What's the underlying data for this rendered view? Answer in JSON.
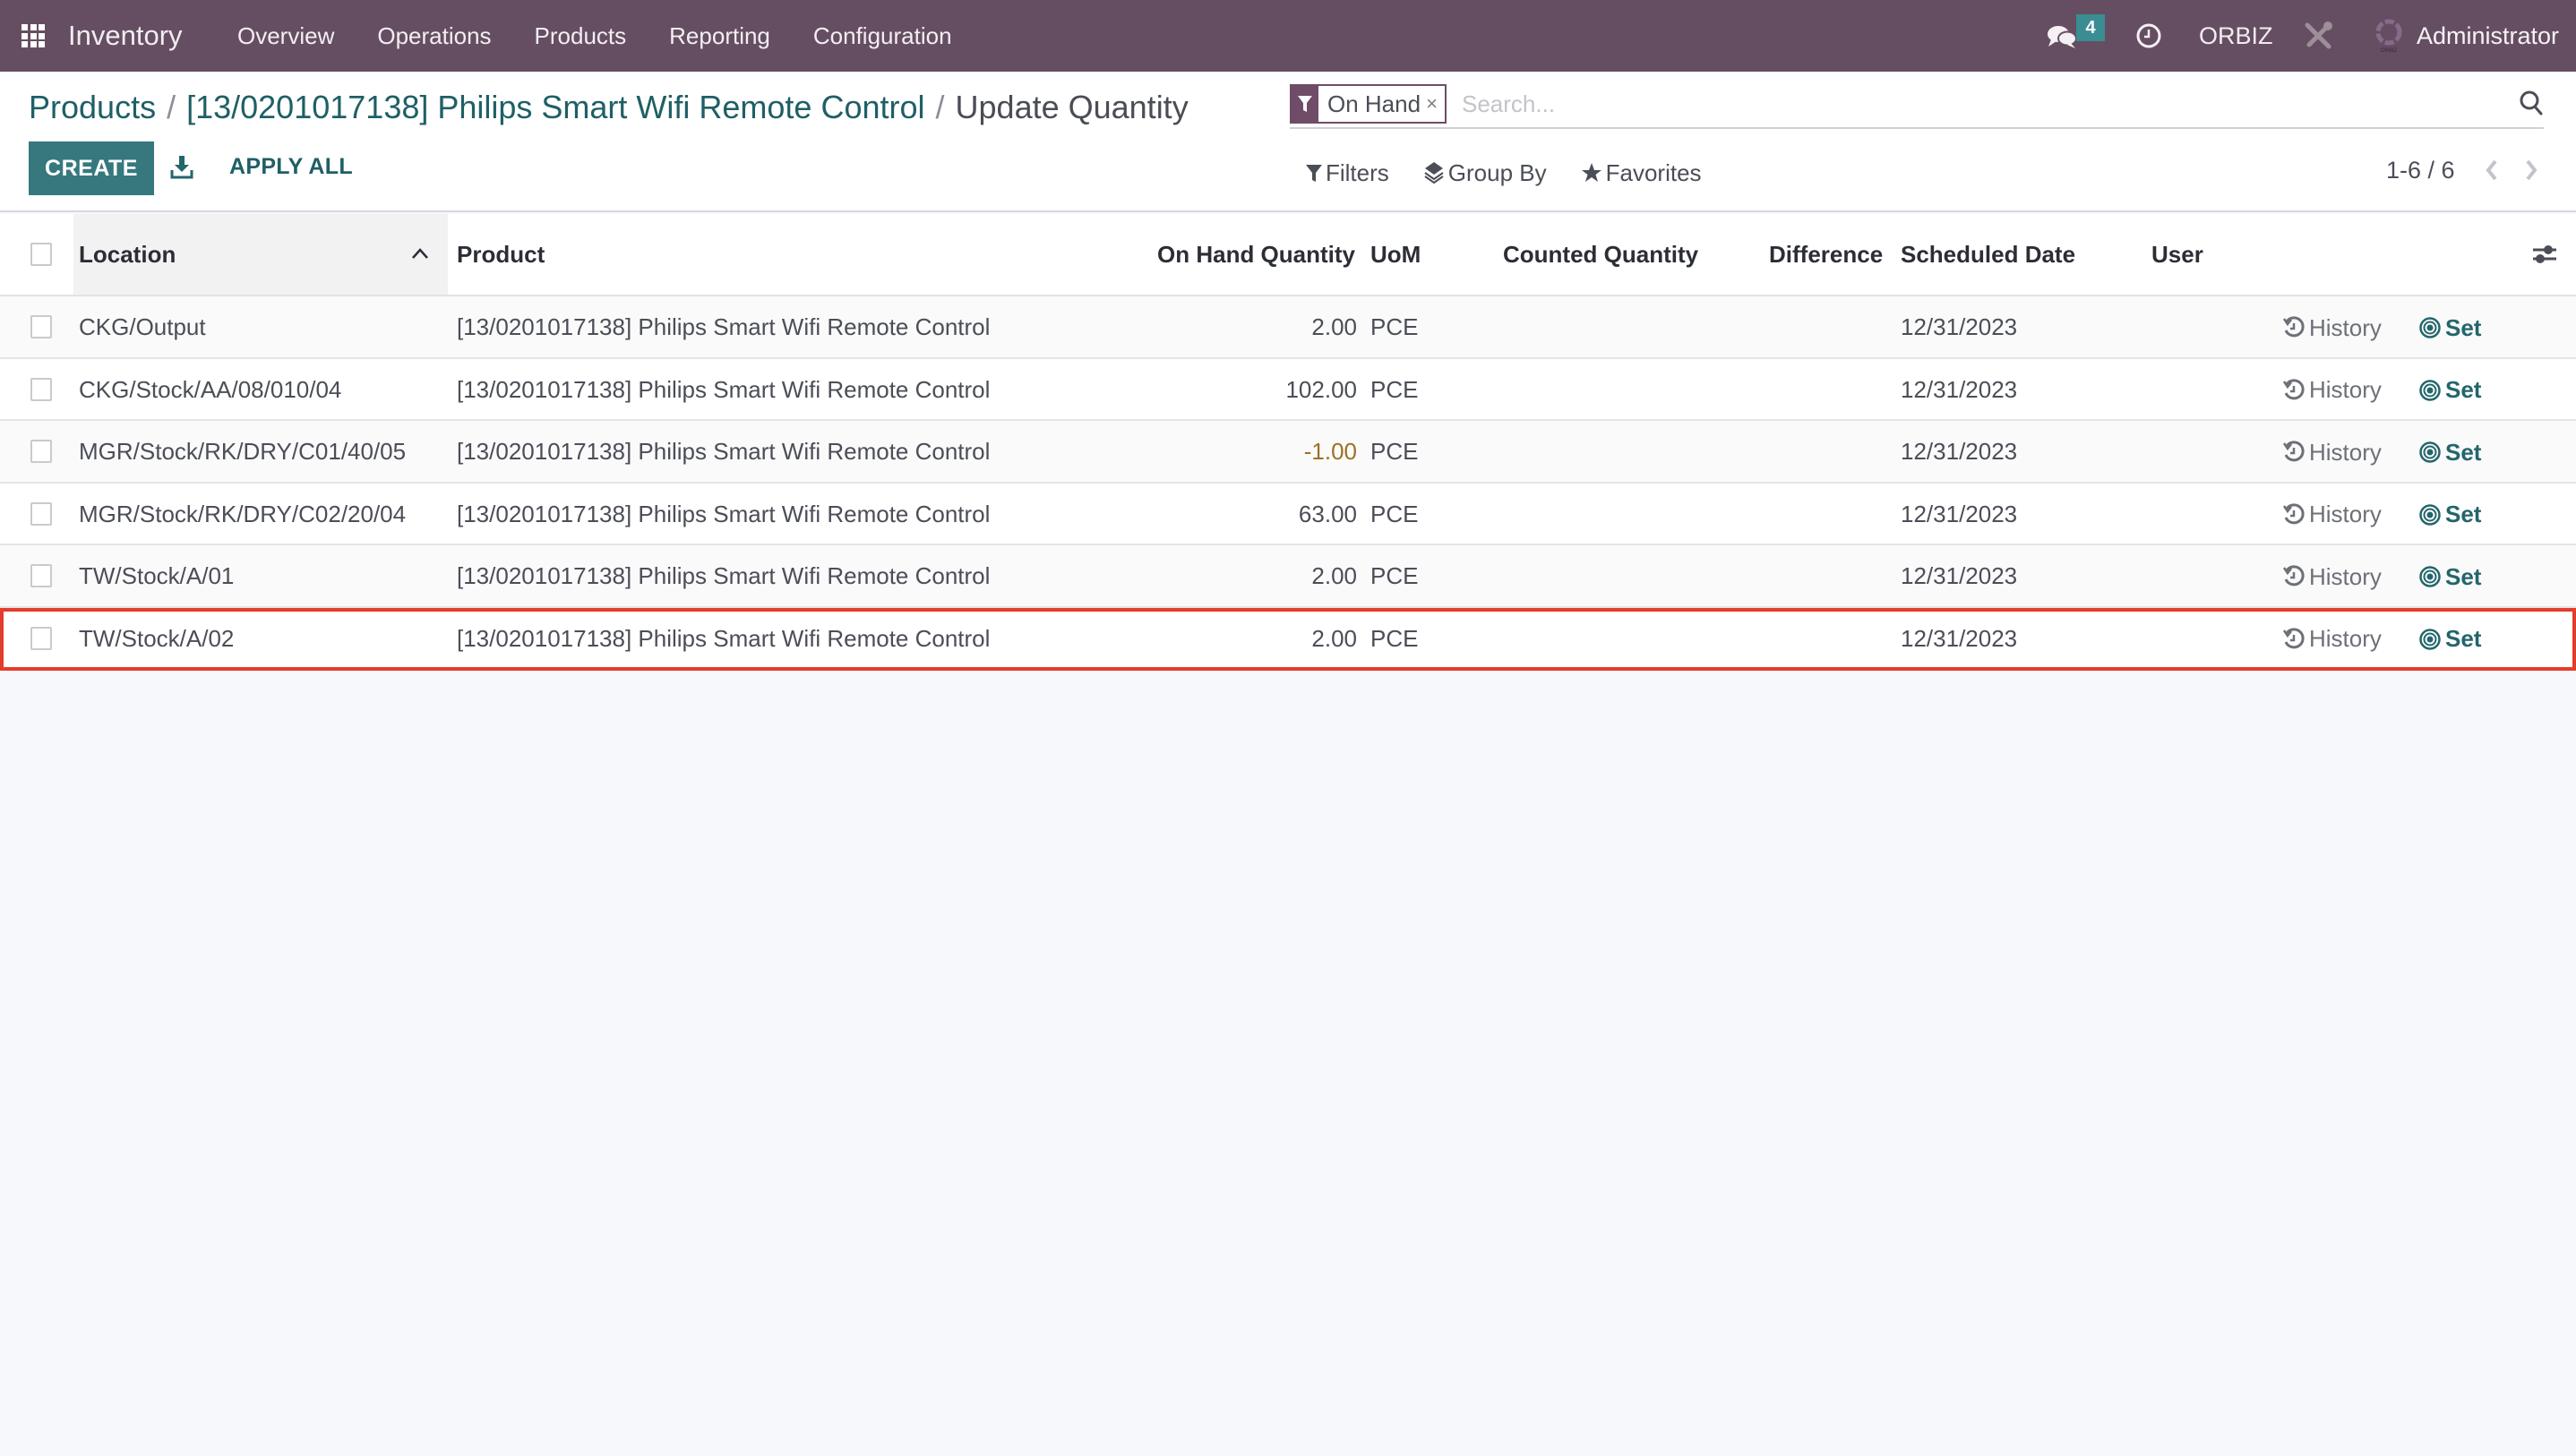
{
  "navbar": {
    "app_name": "Inventory",
    "menu": [
      "Overview",
      "Operations",
      "Products",
      "Reporting",
      "Configuration"
    ],
    "messages_count": "4",
    "company": "ORBIZ",
    "user": "Administrator",
    "colors": {
      "background": "#664e62",
      "badge": "#3a8d93"
    }
  },
  "breadcrumb": {
    "items": [
      "Products",
      "[13/0201017138] Philips Smart Wifi Remote Control"
    ],
    "current": "Update Quantity",
    "separator": "/"
  },
  "toolbar": {
    "create_label": "CREATE",
    "apply_all_label": "APPLY ALL",
    "accent_color": "#36787d"
  },
  "search": {
    "facet_label": "On Hand",
    "facet_remove": "×",
    "placeholder": "Search...",
    "value": ""
  },
  "filters": {
    "filters_label": "Filters",
    "group_by_label": "Group By",
    "favorites_label": "Favorites"
  },
  "pager": {
    "value": "1-6 / 6"
  },
  "table": {
    "columns": [
      "Location",
      "Product",
      "On Hand Quantity",
      "UoM",
      "Counted Quantity",
      "Difference",
      "Scheduled Date",
      "User"
    ],
    "sorted_by": "Location",
    "sort_direction": "ascending",
    "action_labels": {
      "history": "History",
      "set": "Set"
    },
    "rows": [
      {
        "location": "CKG/Output",
        "product": "[13/0201017138] Philips Smart Wifi Remote Control",
        "on_hand": "2.00",
        "uom": "PCE",
        "counted": "",
        "difference": "",
        "scheduled_date": "12/31/2023",
        "user": "",
        "negative": false
      },
      {
        "location": "CKG/Stock/AA/08/010/04",
        "product": "[13/0201017138] Philips Smart Wifi Remote Control",
        "on_hand": "102.00",
        "uom": "PCE",
        "counted": "",
        "difference": "",
        "scheduled_date": "12/31/2023",
        "user": "",
        "negative": false
      },
      {
        "location": "MGR/Stock/RK/DRY/C01/40/05",
        "product": "[13/0201017138] Philips Smart Wifi Remote Control",
        "on_hand": "-1.00",
        "uom": "PCE",
        "counted": "",
        "difference": "",
        "scheduled_date": "12/31/2023",
        "user": "",
        "negative": true
      },
      {
        "location": "MGR/Stock/RK/DRY/C02/20/04",
        "product": "[13/0201017138] Philips Smart Wifi Remote Control",
        "on_hand": "63.00",
        "uom": "PCE",
        "counted": "",
        "difference": "",
        "scheduled_date": "12/31/2023",
        "user": "",
        "negative": false
      },
      {
        "location": "TW/Stock/A/01",
        "product": "[13/0201017138] Philips Smart Wifi Remote Control",
        "on_hand": "2.00",
        "uom": "PCE",
        "counted": "",
        "difference": "",
        "scheduled_date": "12/31/2023",
        "user": "",
        "negative": false
      },
      {
        "location": "TW/Stock/A/02",
        "product": "[13/0201017138] Philips Smart Wifi Remote Control",
        "on_hand": "2.00",
        "uom": "PCE",
        "counted": "",
        "difference": "",
        "scheduled_date": "12/31/2023",
        "user": "",
        "negative": false,
        "highlighted": true
      }
    ],
    "colors": {
      "negative_value": "#9b7223",
      "highlight_border": "#e43d2b",
      "set_action": "#23666b"
    }
  }
}
